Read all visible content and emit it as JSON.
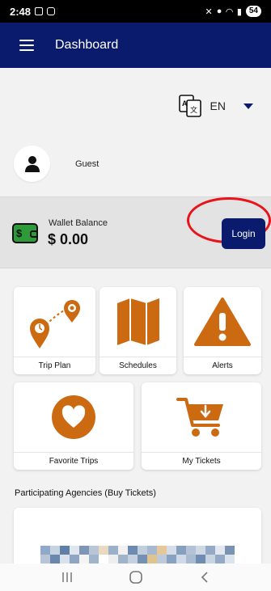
{
  "status_bar": {
    "time": "2:48",
    "battery": "54"
  },
  "app_bar": {
    "title": "Dashboard"
  },
  "language": {
    "code": "EN"
  },
  "user": {
    "name": "Guest"
  },
  "wallet": {
    "label": "Wallet Balance",
    "amount": "$ 0.00",
    "icon_text": "$",
    "login_label": "Login"
  },
  "tiles": [
    {
      "label": "Trip Plan",
      "icon": "trip-plan-icon"
    },
    {
      "label": "Schedules",
      "icon": "map-icon"
    },
    {
      "label": "Alerts",
      "icon": "alert-icon"
    },
    {
      "label": "Favorite Trips",
      "icon": "heart-icon"
    },
    {
      "label": "My Tickets",
      "icon": "cart-icon"
    }
  ],
  "agencies": {
    "heading": "Participating Agencies (Buy Tickets)"
  },
  "colors": {
    "brand_navy": "#0a1b6e",
    "accent_orange": "#cc6a12",
    "wallet_green": "#2e9b3a",
    "highlight_red": "#e8141b"
  }
}
